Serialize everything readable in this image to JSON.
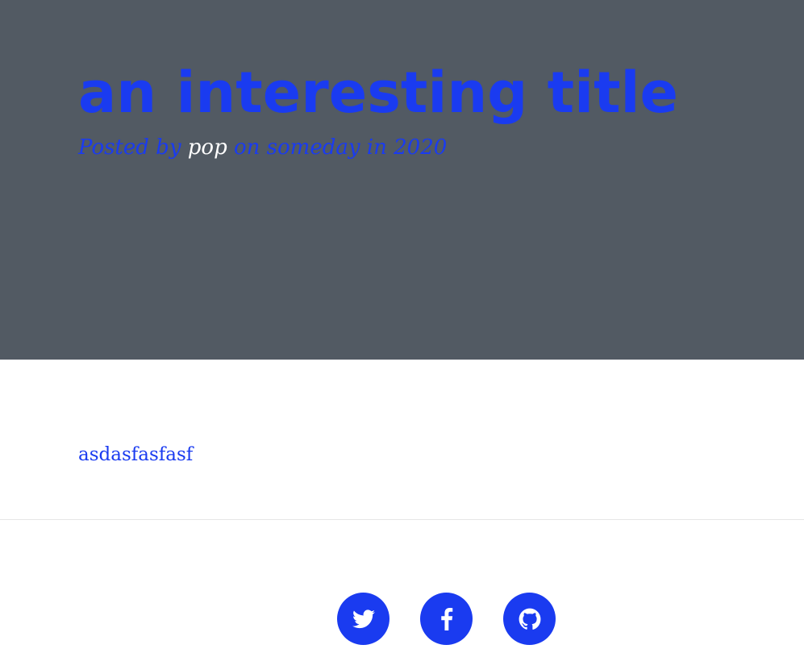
{
  "post": {
    "title": "an interesting title",
    "meta_prefix": "Posted by",
    "author": "pop",
    "meta_suffix": "on someday in 2020"
  },
  "content": {
    "body": "asdasfasfasf"
  },
  "footer": {
    "social": [
      {
        "name": "twitter",
        "icon": "twitter-icon"
      },
      {
        "name": "facebook",
        "icon": "facebook-icon"
      },
      {
        "name": "github",
        "icon": "github-icon"
      }
    ]
  },
  "colors": {
    "masthead_bg": "#525a63",
    "accent": "#1a3bf0",
    "author_text": "#ffffff"
  }
}
